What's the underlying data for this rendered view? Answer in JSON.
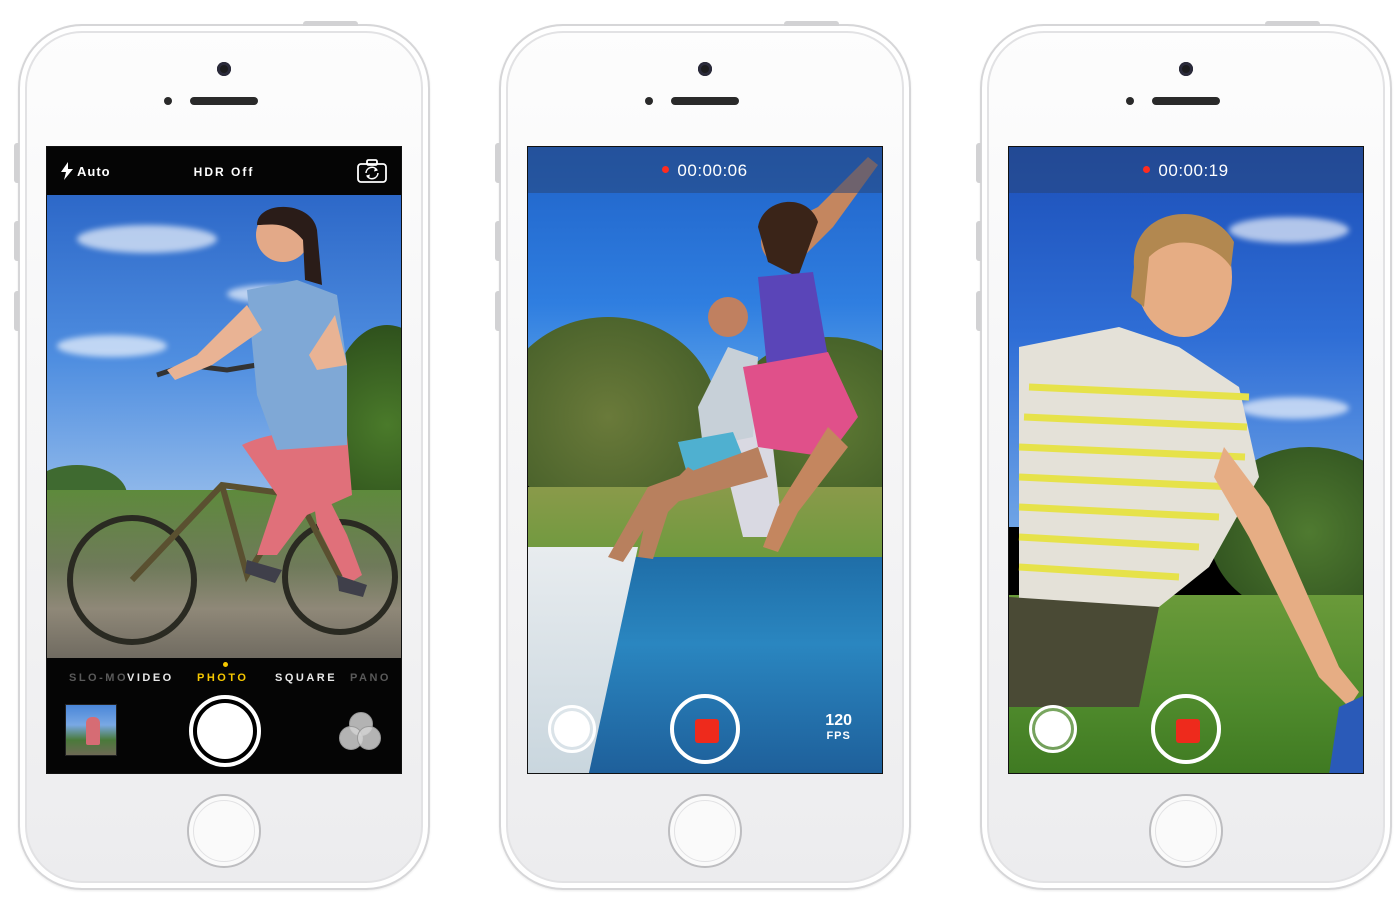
{
  "phones": [
    {
      "mode": "photo",
      "flash_label": "Auto",
      "hdr_label": "HDR Off",
      "modes": [
        "SLO-MO",
        "VIDEO",
        "PHOTO",
        "SQUARE",
        "PANO"
      ],
      "active_mode": "PHOTO"
    },
    {
      "mode": "video",
      "timer": "00:00:06",
      "fps_value": "120",
      "fps_unit": "FPS"
    },
    {
      "mode": "video",
      "timer": "00:00:19"
    }
  ],
  "icons": {
    "flash": "flash-icon",
    "switch_camera": "switch-camera-icon",
    "filters": "filters-icon",
    "record": "record-icon"
  },
  "colors": {
    "active_mode": "#f6c800",
    "record_red": "#ee2a1c",
    "sky_blue": "#3f7fd6"
  }
}
